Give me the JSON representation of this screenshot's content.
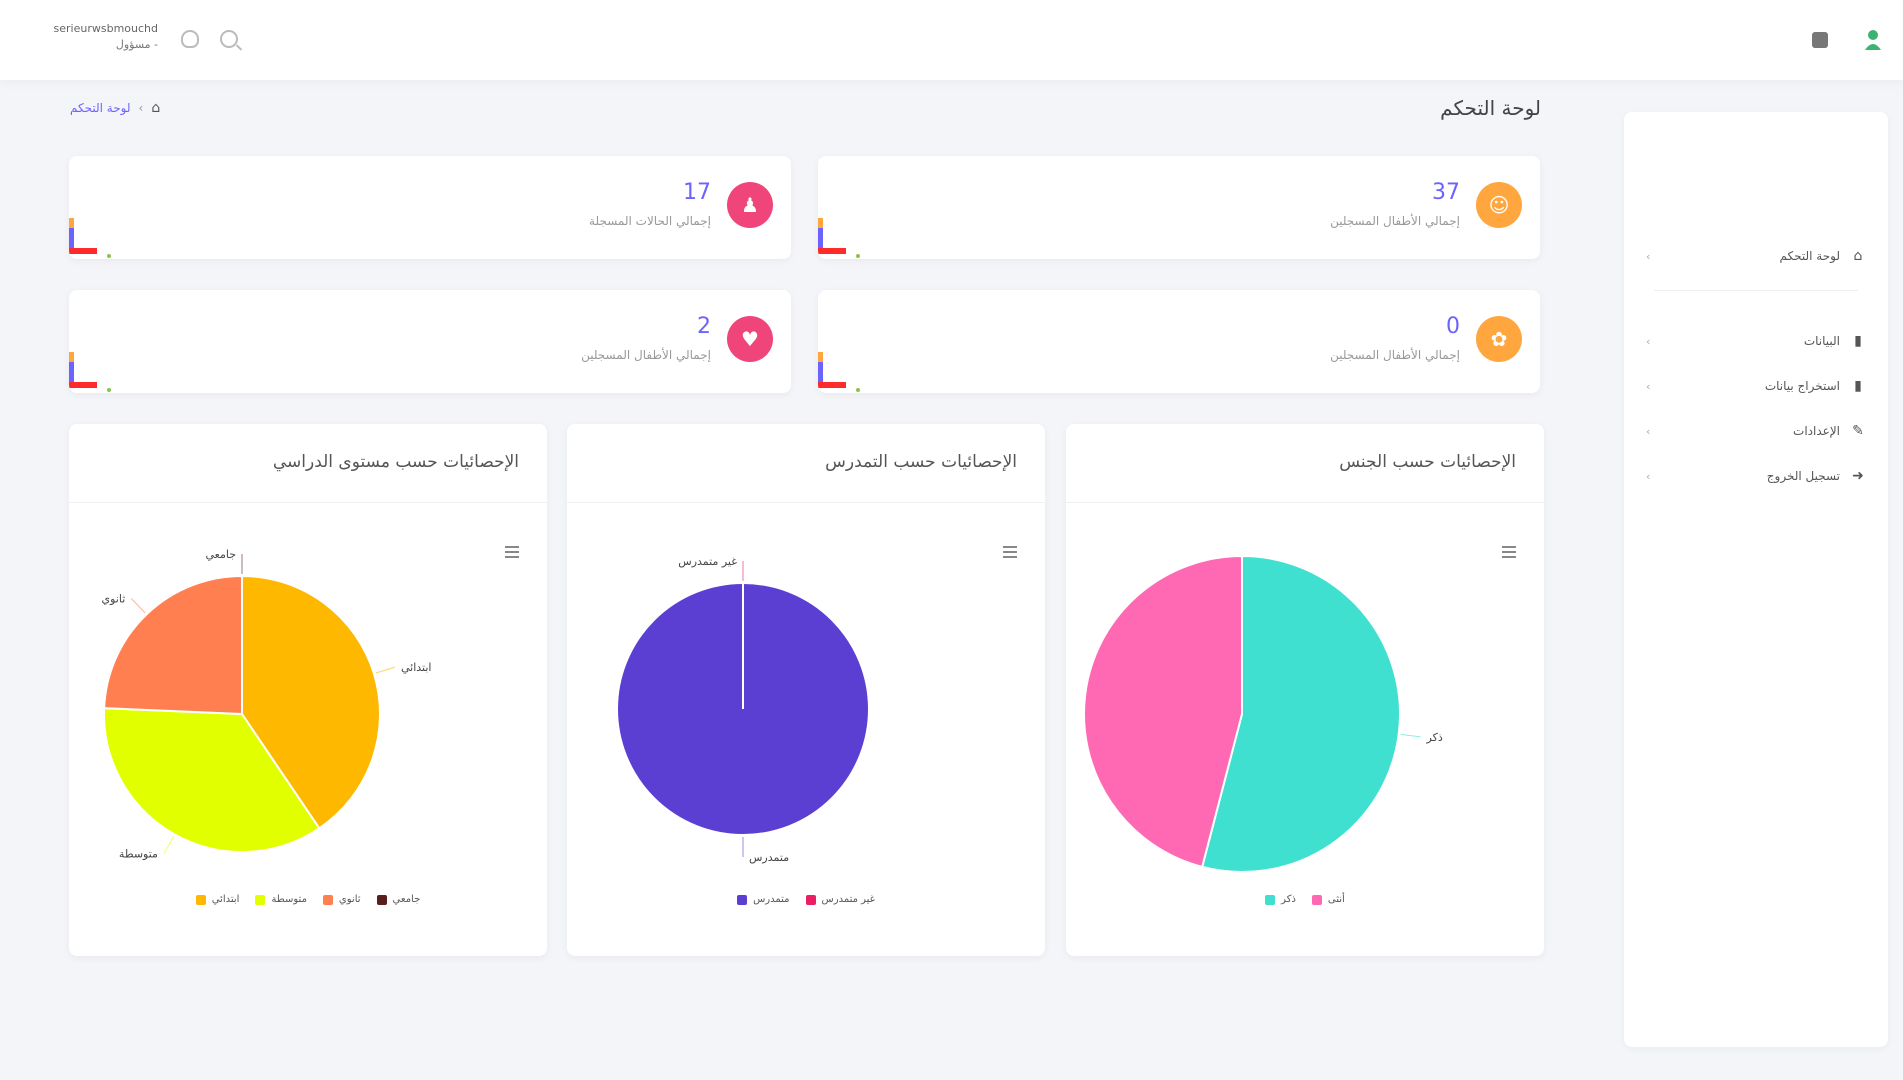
{
  "topbar": {
    "user_email": "serieurwsbmouchd",
    "user_role": "مسؤول -",
    "icons": [
      "bell-icon",
      "search-icon",
      "menu-icon",
      "logo"
    ]
  },
  "sidebar": {
    "items": [
      {
        "label": "لوحة التحكم",
        "icon": "dashboard-icon"
      },
      {
        "label": "البيانات",
        "icon": "file-icon"
      },
      {
        "label": "استخراج بيانات",
        "icon": "file-export-icon"
      },
      {
        "label": "الإعدادات",
        "icon": "pen-icon"
      },
      {
        "label": "تسجيل الخروج",
        "icon": "logout-icon"
      }
    ]
  },
  "page": {
    "title": "لوحة التحكم",
    "breadcrumb_link": "لوحة التحكم"
  },
  "stats": [
    {
      "value": "37",
      "label": "إجمالي الأطفال المسجلين",
      "color": "#ffa63e"
    },
    {
      "value": "17",
      "label": "إجمالي الحالات المسجلة",
      "color": "#f0457a"
    },
    {
      "value": "0",
      "label": "إجمالي الأطفال المسجلين",
      "color": "#ffa63e"
    },
    {
      "value": "2",
      "label": "إجمالي الأطفال المسجلين",
      "color": "#f0457a"
    }
  ],
  "colors": {
    "accent": "#6c63ff",
    "orange": "#ffa63e",
    "pink": "#f0457a"
  },
  "chart_data": [
    {
      "type": "pie",
      "title": "الإحصائيات حسب الجنس",
      "categories": [
        "ذكر",
        "أنثى"
      ],
      "values": [
        20,
        17
      ],
      "colors": [
        "#40e0d0",
        "#ff69b4"
      ],
      "slice_labels": [
        "ذكر",
        ""
      ],
      "legend_position": "bottom"
    },
    {
      "type": "pie",
      "title": "الإحصائيات حسب التمدرس",
      "categories": [
        "متمدرس",
        "غير متمدرس"
      ],
      "values": [
        37,
        0
      ],
      "colors": [
        "#5b3fd3",
        "#e91e63"
      ],
      "slice_labels": [
        "متمدرس",
        "غير متمدرس"
      ],
      "legend_position": "bottom"
    },
    {
      "type": "pie",
      "title": "الإحصائيات حسب مستوى الدراسي",
      "categories": [
        "ابتدائي",
        "متوسطة",
        "ثانوي",
        "جامعي"
      ],
      "values": [
        15,
        13,
        9,
        0
      ],
      "colors": [
        "#ffb800",
        "#e2ff00",
        "#ff7f50",
        "#5a1e1e"
      ],
      "slice_labels": [
        "ابتدائي",
        "متوسطة",
        "ثانوي",
        "جامعي"
      ],
      "legend_position": "bottom"
    }
  ]
}
